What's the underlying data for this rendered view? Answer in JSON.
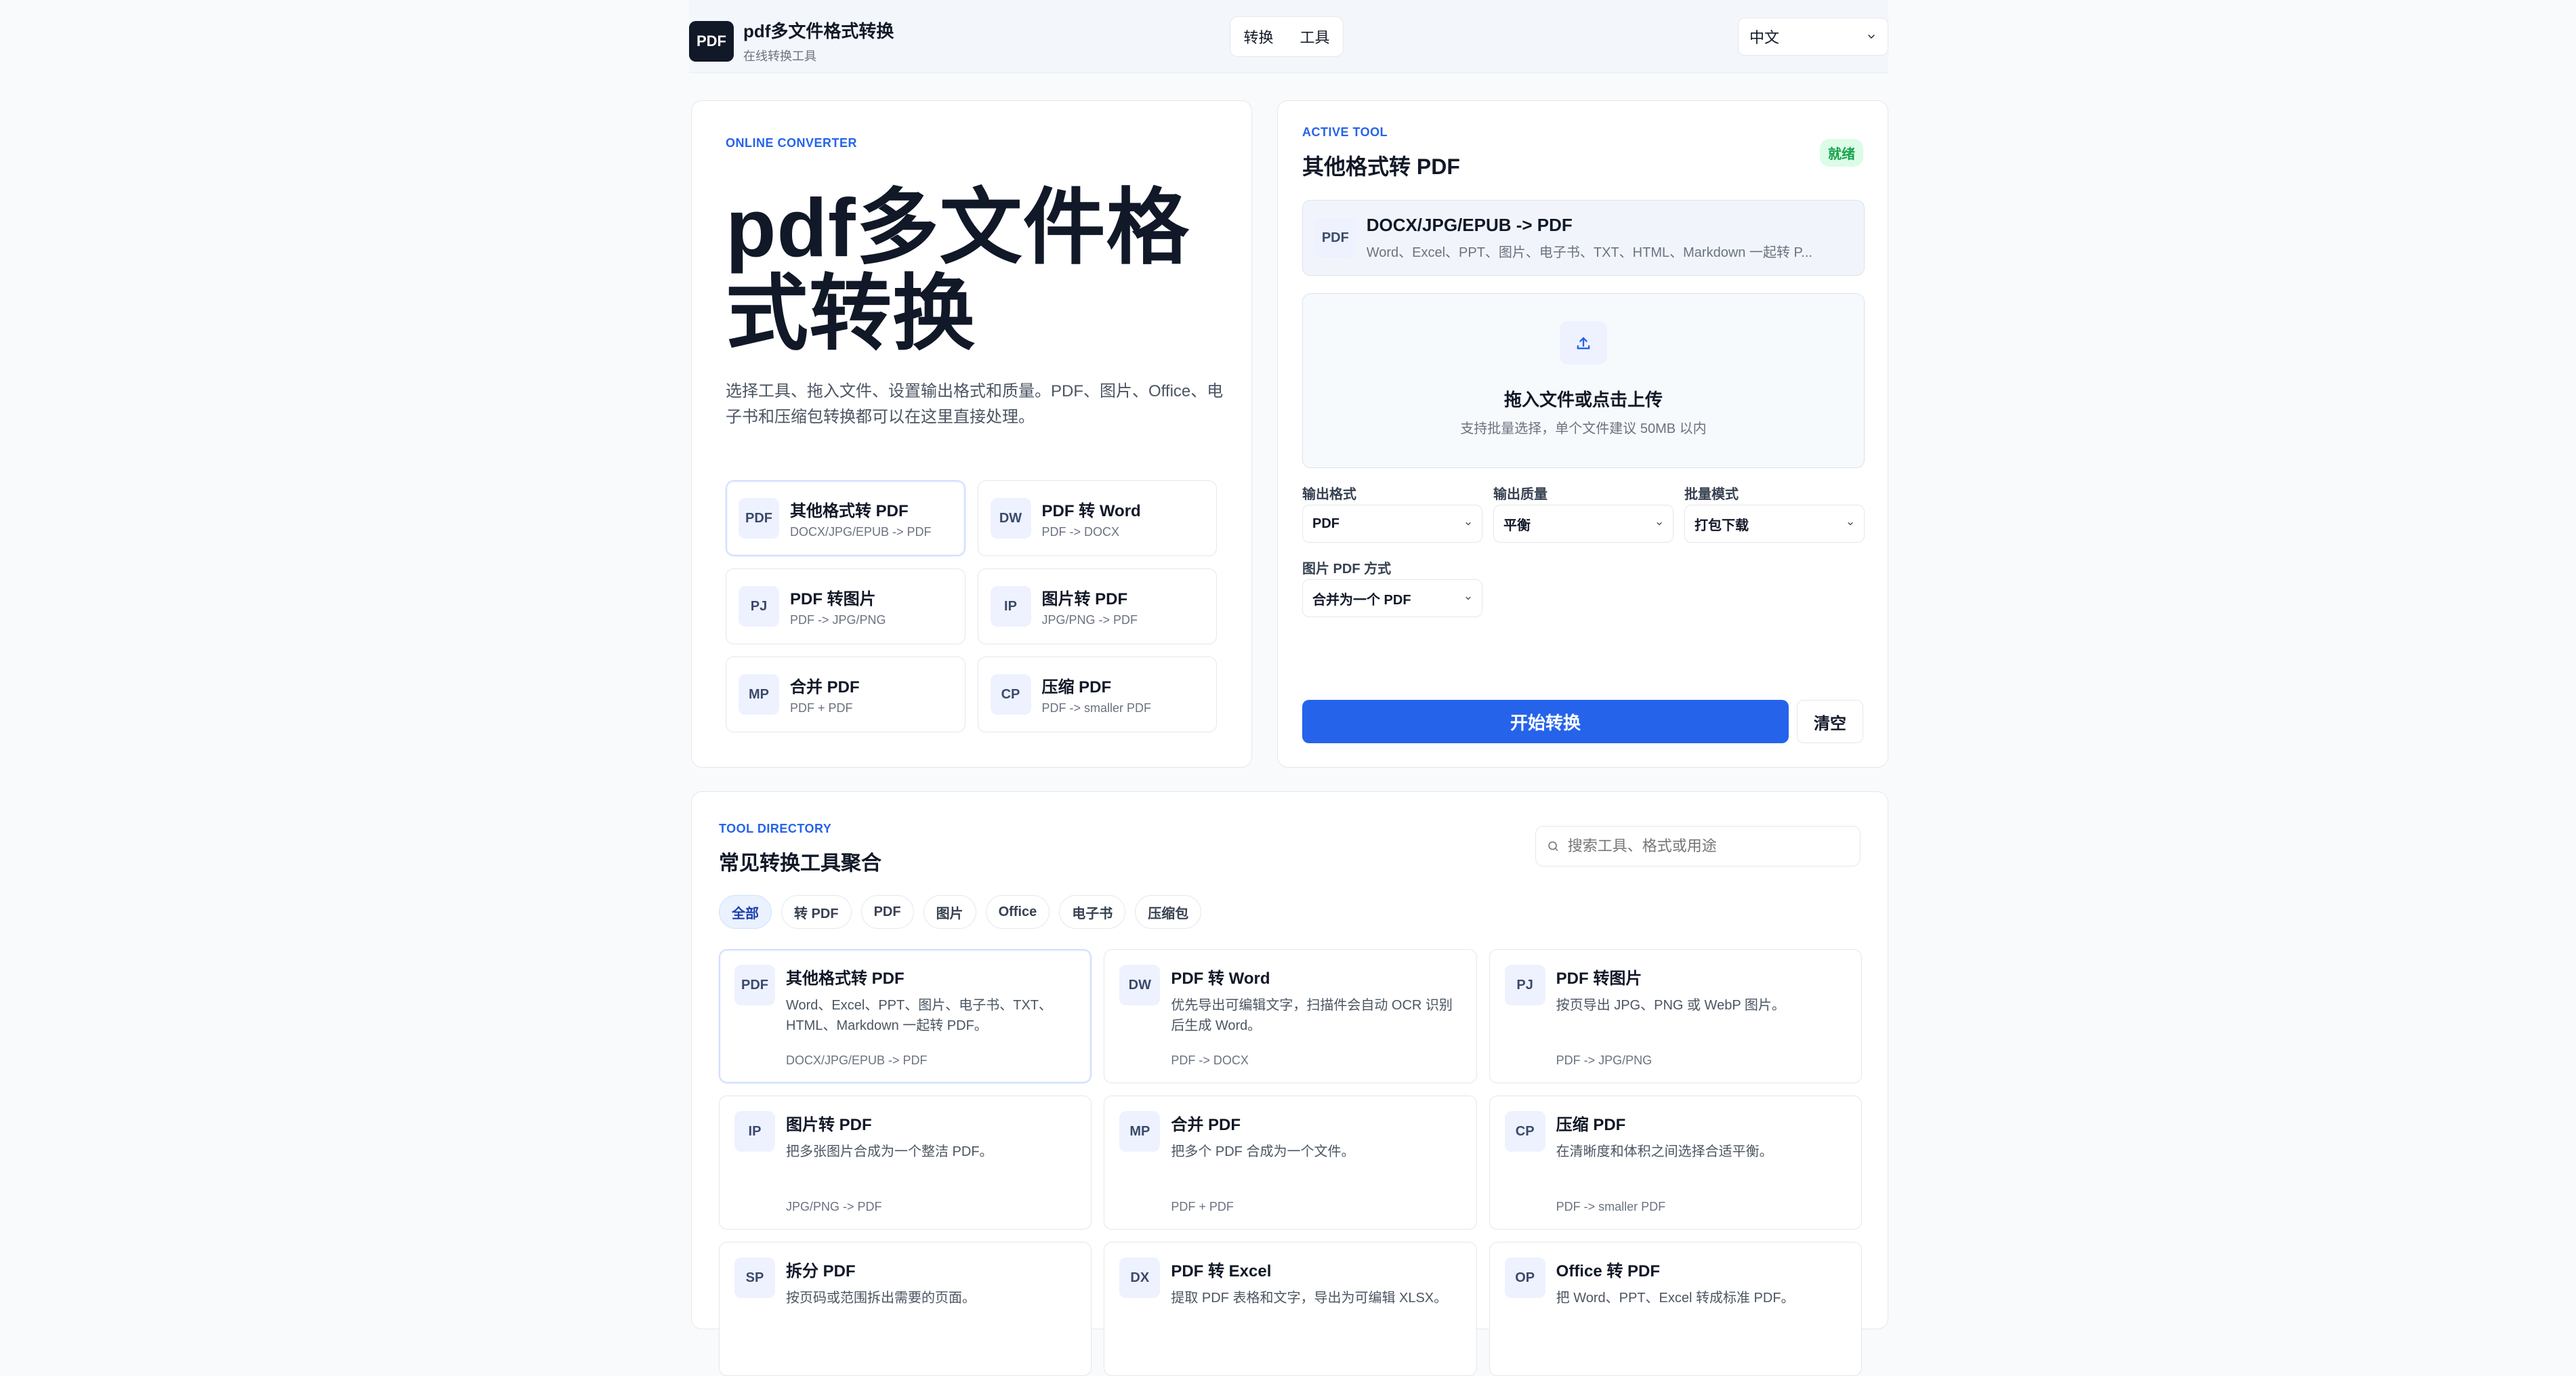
{
  "brand": {
    "logo_text": "PDF",
    "title": "pdf多文件格式转换",
    "subtitle": "在线转换工具"
  },
  "nav": {
    "convert": "转换",
    "tools": "工具"
  },
  "language": {
    "selected": "中文"
  },
  "left": {
    "overline": "ONLINE CONVERTER",
    "title": "pdf多文件格式转换",
    "desc": "选择工具、拖入文件、设置输出格式和质量。PDF、图片、Office、电子书和压缩包转换都可以在这里直接处理。",
    "tiles": [
      {
        "icon": "PDF",
        "title": "其他格式转 PDF",
        "sub": "DOCX/JPG/EPUB -> PDF"
      },
      {
        "icon": "DW",
        "title": "PDF 转 Word",
        "sub": "PDF -> DOCX"
      },
      {
        "icon": "PJ",
        "title": "PDF 转图片",
        "sub": "PDF -> JPG/PNG"
      },
      {
        "icon": "IP",
        "title": "图片转 PDF",
        "sub": "JPG/PNG -> PDF"
      },
      {
        "icon": "MP",
        "title": "合并 PDF",
        "sub": "PDF + PDF"
      },
      {
        "icon": "CP",
        "title": "压缩 PDF",
        "sub": "PDF -> smaller PDF"
      }
    ]
  },
  "right": {
    "overline": "ACTIVE TOOL",
    "title": "其他格式转 PDF",
    "status": "就绪",
    "selected": {
      "icon": "PDF",
      "title": "DOCX/JPG/EPUB -> PDF",
      "desc": "Word、Excel、PPT、图片、电子书、TXT、HTML、Markdown 一起转 P..."
    },
    "upload": {
      "title": "拖入文件或点击上传",
      "sub": "支持批量选择，单个文件建议 50MB 以内"
    },
    "labels": {
      "output_format": "输出格式",
      "output_quality": "输出质量",
      "batch_mode": "批量模式",
      "image_pdf_mode": "图片 PDF 方式"
    },
    "values": {
      "output_format": "PDF",
      "output_quality": "平衡",
      "batch_mode": "打包下载",
      "image_pdf_mode": "合并为一个 PDF"
    },
    "start": "开始转换",
    "clear": "清空"
  },
  "directory": {
    "overline": "TOOL DIRECTORY",
    "title": "常见转换工具聚合",
    "search_placeholder": "搜索工具、格式或用途",
    "chips": [
      "全部",
      "转 PDF",
      "PDF",
      "图片",
      "Office",
      "电子书",
      "压缩包"
    ],
    "items": [
      {
        "icon": "PDF",
        "name": "其他格式转 PDF",
        "desc": "Word、Excel、PPT、图片、电子书、TXT、HTML、Markdown 一起转 PDF。",
        "path": "DOCX/JPG/EPUB -> PDF"
      },
      {
        "icon": "DW",
        "name": "PDF 转 Word",
        "desc": "优先导出可编辑文字，扫描件会自动 OCR 识别后生成 Word。",
        "path": "PDF -> DOCX"
      },
      {
        "icon": "PJ",
        "name": "PDF 转图片",
        "desc": "按页导出 JPG、PNG 或 WebP 图片。",
        "path": "PDF -> JPG/PNG"
      },
      {
        "icon": "IP",
        "name": "图片转 PDF",
        "desc": "把多张图片合成为一个整洁 PDF。",
        "path": "JPG/PNG -> PDF"
      },
      {
        "icon": "MP",
        "name": "合并 PDF",
        "desc": "把多个 PDF 合成为一个文件。",
        "path": "PDF + PDF"
      },
      {
        "icon": "CP",
        "name": "压缩 PDF",
        "desc": "在清晰度和体积之间选择合适平衡。",
        "path": "PDF -> smaller PDF"
      },
      {
        "icon": "SP",
        "name": "拆分 PDF",
        "desc": "按页码或范围拆出需要的页面。",
        "path": ""
      },
      {
        "icon": "DX",
        "name": "PDF 转 Excel",
        "desc": "提取 PDF 表格和文字，导出为可编辑 XLSX。",
        "path": ""
      },
      {
        "icon": "OP",
        "name": "Office 转 PDF",
        "desc": "把 Word、PPT、Excel 转成标准 PDF。",
        "path": ""
      }
    ]
  },
  "colors": {
    "accent": "#2563eb",
    "success": "#16a34a"
  }
}
